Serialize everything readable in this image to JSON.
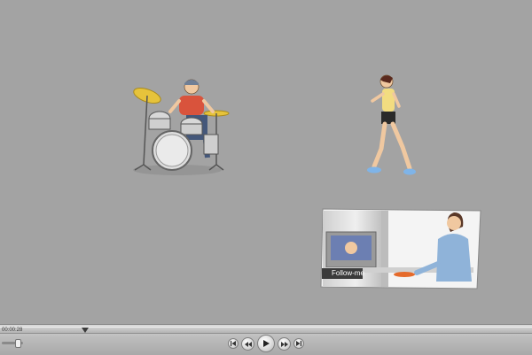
{
  "stage": {
    "background_color": "#a3a3a3",
    "clips": [
      {
        "id": "drummer",
        "description_icon": "drummer-clip"
      },
      {
        "id": "runner",
        "description_icon": "runner-clip"
      },
      {
        "id": "follow-me-video",
        "description_icon": "video-clip",
        "label": "Follow-me"
      }
    ]
  },
  "player": {
    "time": "00:00:28",
    "volume_level": 0.75,
    "playhead_fraction": 0.16,
    "controls": {
      "start": "skip-to-start-icon",
      "rewind": "rewind-icon",
      "play": "play-icon",
      "fast_forward": "fast-forward-icon",
      "end": "skip-to-end-icon"
    }
  }
}
